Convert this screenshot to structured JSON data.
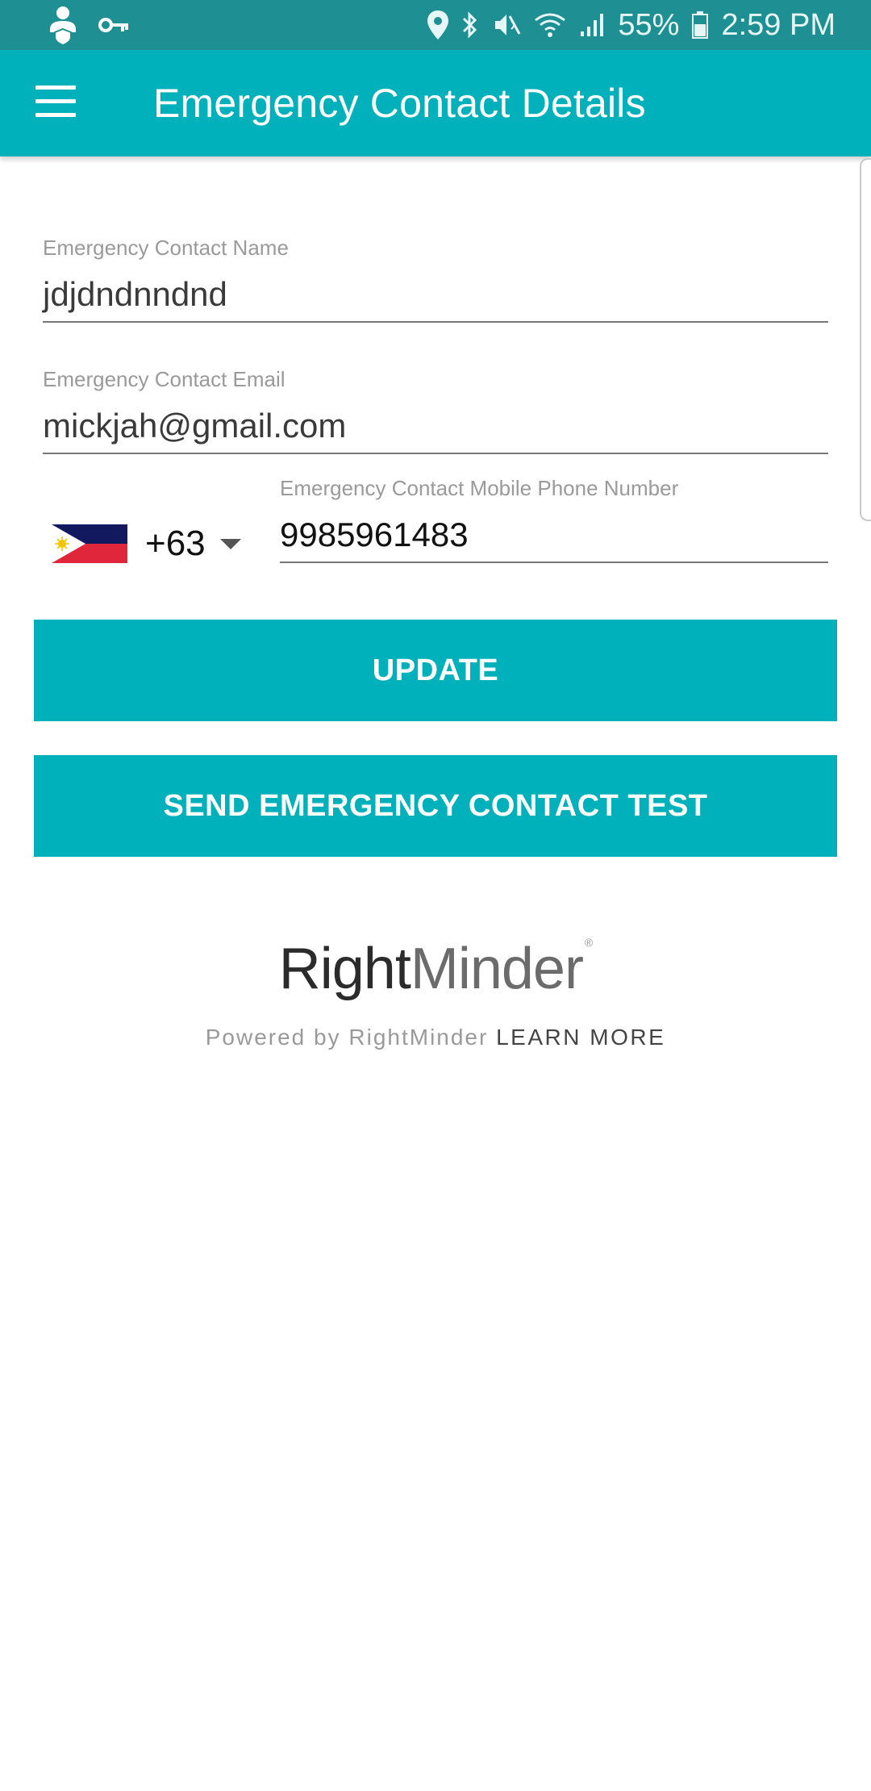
{
  "status_bar": {
    "battery": "55%",
    "time": "2:59 PM",
    "icons": [
      "user-shield-icon",
      "key-icon",
      "location-icon",
      "bluetooth-icon",
      "mute-icon",
      "wifi-icon",
      "signal-icon",
      "battery-icon"
    ]
  },
  "app_bar": {
    "title": "Emergency Contact Details",
    "menu_icon": "hamburger-menu-icon",
    "color": "#00b0bb"
  },
  "form": {
    "name": {
      "label": "Emergency Contact Name",
      "value": "jdjdndnndnd"
    },
    "email": {
      "label": "Emergency Contact Email",
      "value": "mickjah@gmail.com"
    },
    "phone": {
      "label": "Emergency Contact Mobile Phone Number",
      "country_code": "+63",
      "country_flag": "philippines-flag-icon",
      "value": "9985961483"
    }
  },
  "buttons": {
    "update": "UPDATE",
    "send_test": "SEND EMERGENCY CONTACT TEST"
  },
  "footer": {
    "brand_part1": "Right",
    "brand_part2": "Minder",
    "brand_mark": "®",
    "powered_by": "Powered by RightMinder",
    "learn_more": "LEARN MORE"
  }
}
